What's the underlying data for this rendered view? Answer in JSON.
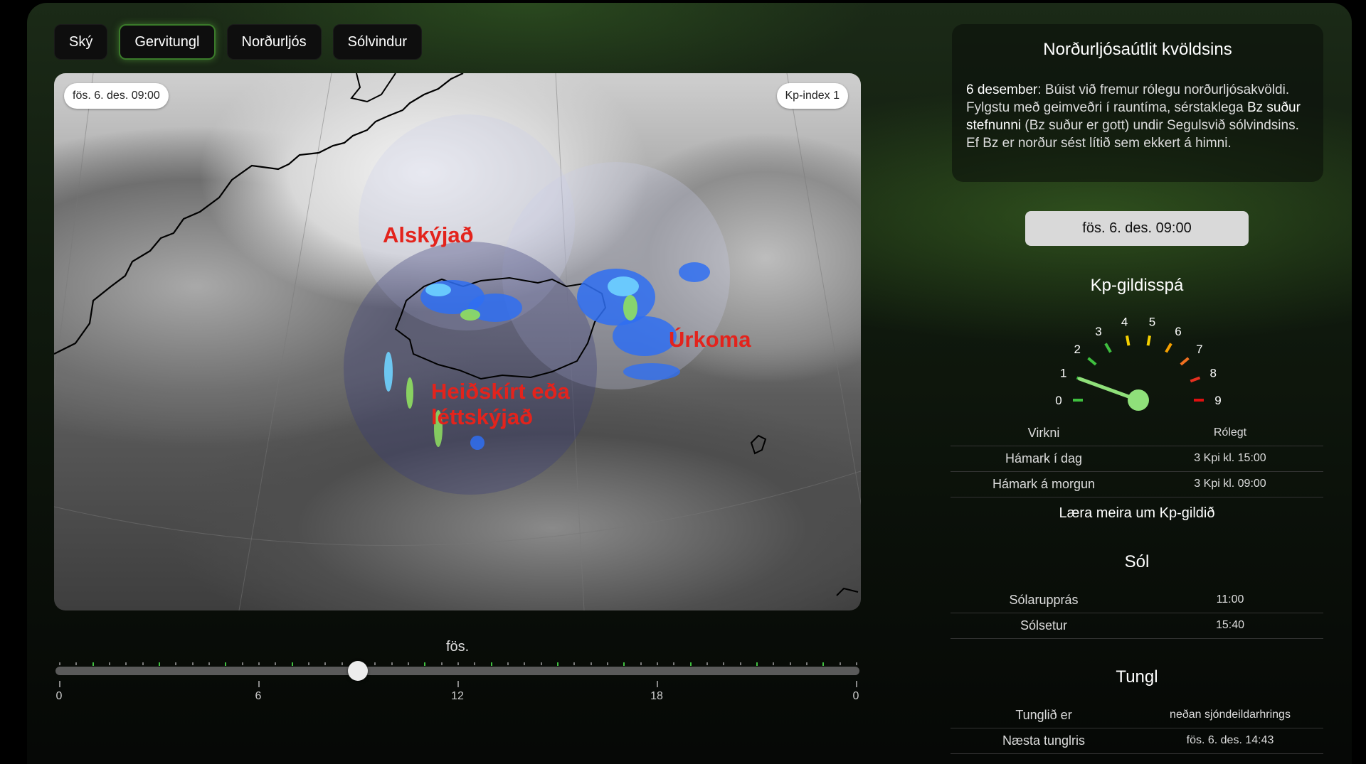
{
  "tabs": [
    {
      "label": "Ský",
      "active": false
    },
    {
      "label": "Gervitungl",
      "active": true
    },
    {
      "label": "Norðurljós",
      "active": false
    },
    {
      "label": "Sólvindur",
      "active": false
    }
  ],
  "map": {
    "timestamp": "fös. 6. des. 09:00",
    "kp_badge": "Kp-index 1",
    "labels": {
      "cloudy": "Alskýjað",
      "precip": "Úrkoma",
      "clear": "Heiðskírt eða léttskýjað"
    }
  },
  "timeline": {
    "day": "fös.",
    "ticks": [
      "0",
      "6",
      "12",
      "18",
      "0"
    ],
    "position_hours": 9
  },
  "outlook": {
    "title": "Norðurljósaútlit kvöldsins",
    "date": "6 desember",
    "text_a": ": Búist við fremur rólegu norðurljósakvöldi. Fylgstu með geimveðri í rauntíma, sérstaklega ",
    "bold_a": "Bz suður stefnunni",
    "text_b": " (Bz suður er gott) undir Segulsvið sólvindsins. Ef Bz er norður sést lítið sem ekkert á himni."
  },
  "selected_time": "fös. 6. des. 09:00",
  "kp": {
    "title": "Kp-gildisspá",
    "value": 1,
    "scale": [
      "0",
      "1",
      "2",
      "3",
      "4",
      "5",
      "6",
      "7",
      "8",
      "9"
    ],
    "colors": [
      "#3fbf3f",
      "#3fbf3f",
      "#3fbf3f",
      "#3fbf3f",
      "#f5d000",
      "#f5d000",
      "#f5a000",
      "#f07020",
      "#e53020",
      "#e01010"
    ],
    "rows": [
      {
        "k": "Virkni",
        "v": "Rólegt"
      },
      {
        "k": "Hámark í dag",
        "v": "3 Kpi kl. 15:00"
      },
      {
        "k": "Hámark á morgun",
        "v": "3 Kpi kl. 09:00"
      }
    ],
    "learn_more": "Læra meira um Kp-gildið"
  },
  "sun": {
    "title": "Sól",
    "rows": [
      {
        "k": "Sólarupprás",
        "v": "11:00"
      },
      {
        "k": "Sólsetur",
        "v": "15:40"
      }
    ]
  },
  "moon": {
    "title": "Tungl",
    "rows": [
      {
        "k": "Tunglið er",
        "v": "neðan sjóndeildarhrings"
      },
      {
        "k": "Næsta tunglris",
        "v": "fös. 6. des. 14:43"
      }
    ]
  }
}
